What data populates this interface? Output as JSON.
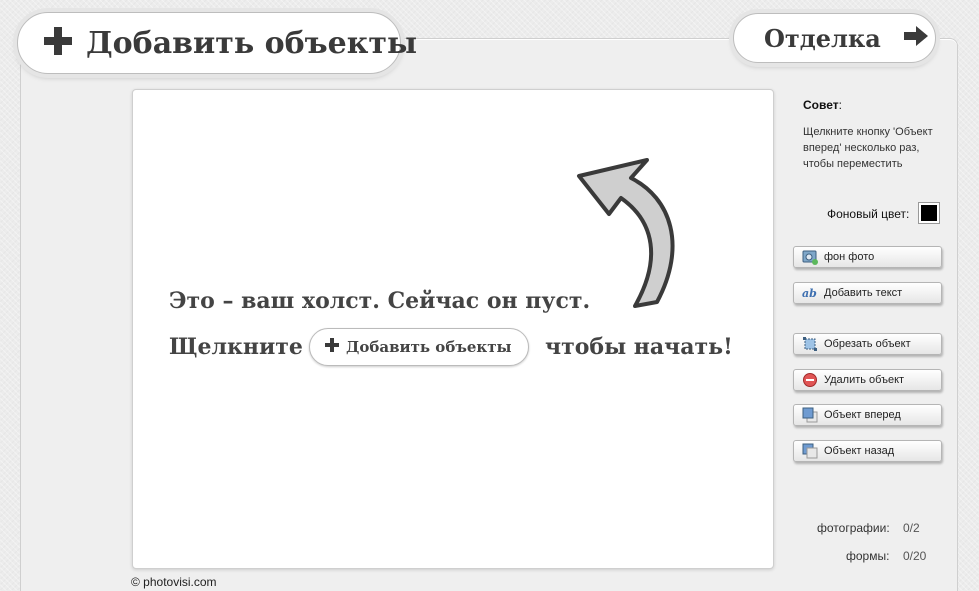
{
  "header": {
    "add_objects_label": "Добавить объекты",
    "finish_label": "Отделка"
  },
  "canvas": {
    "hint_line1": "Это – ваш холст. Сейчас он пуст.",
    "hint_click": "Щелкните",
    "inline_button_label": "Добавить объекты",
    "hint_to_start": "чтобы начать!"
  },
  "sidebar": {
    "tip_title": "Совет",
    "tip_text": "Щелкните кнопку 'Объект вперед' несколько раз, чтобы переместить",
    "background_color_label": "Фоновый цвет:",
    "background_color": "#000000",
    "buttons": [
      {
        "label": "фон фото",
        "icon": "photo-background-icon"
      },
      {
        "label": "Добавить текст",
        "icon": "text-icon"
      },
      {
        "label": "Обрезать объект",
        "icon": "crop-icon"
      },
      {
        "label": "Удалить объект",
        "icon": "delete-icon"
      },
      {
        "label": "Объект вперед",
        "icon": "bring-forward-icon"
      },
      {
        "label": "Объект назад",
        "icon": "send-backward-icon"
      }
    ],
    "counts": {
      "photos_label": "фотографии:",
      "photos_value": "0/2",
      "shapes_label": "формы:",
      "shapes_value": "0/20"
    }
  },
  "footer": {
    "copyright": "© photovisi.com"
  }
}
